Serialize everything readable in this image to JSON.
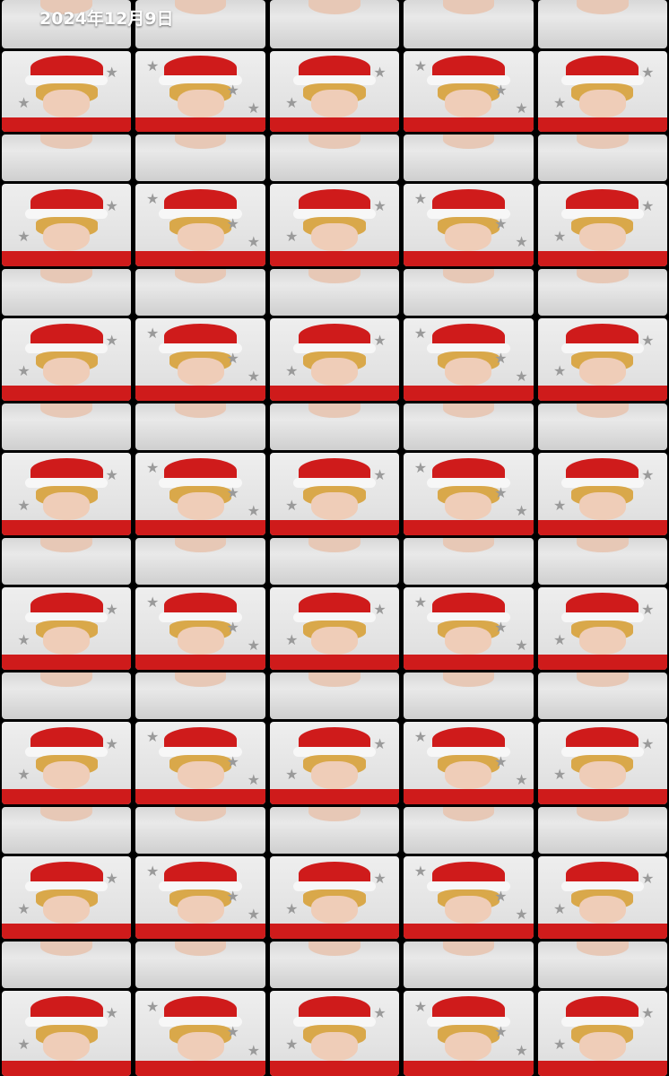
{
  "header": {
    "date": "2024年12月9日"
  },
  "rows": [
    {
      "kind": "hood"
    },
    {
      "kind": "hat"
    },
    {
      "kind": "hood"
    },
    {
      "kind": "hat"
    },
    {
      "kind": "hood"
    },
    {
      "kind": "hat"
    },
    {
      "kind": "hood"
    },
    {
      "kind": "hat"
    },
    {
      "kind": "hood"
    },
    {
      "kind": "hat"
    },
    {
      "kind": "hood"
    },
    {
      "kind": "hat"
    },
    {
      "kind": "hood"
    },
    {
      "kind": "hat"
    },
    {
      "kind": "hood"
    },
    {
      "kind": "hat"
    }
  ]
}
